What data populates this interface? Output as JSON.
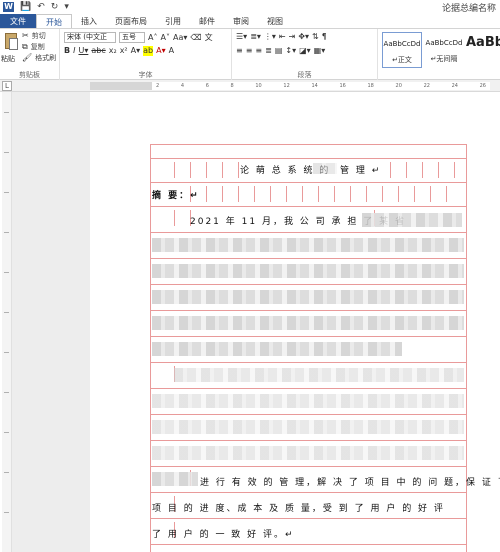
{
  "title_bar": {
    "app_icon": "word-logo",
    "doc_title": "论据总编名称"
  },
  "tabs": [
    "文件",
    "开始",
    "插入",
    "页面布局",
    "引用",
    "邮件",
    "审阅",
    "视图"
  ],
  "active_tab": "开始",
  "ribbon": {
    "clipboard": {
      "paste": "粘贴",
      "cut": "剪切",
      "copy": "复制",
      "format_painter": "格式刷",
      "group_label": "剪贴板"
    },
    "font": {
      "font_name": "宋体 (中文正",
      "font_size": "五号",
      "group_label": "字体"
    },
    "paragraph": {
      "group_label": "段落"
    },
    "styles": {
      "items": [
        {
          "sample": "AaBbCcDd",
          "name": "↵正文"
        },
        {
          "sample": "AaBbCcDd",
          "name": "↵无间隔"
        },
        {
          "sample": "AaBb",
          "name": ""
        }
      ]
    }
  },
  "ruler": {
    "tab_selector": "L",
    "ticks": [
      "4",
      "2",
      "",
      "2",
      "4",
      "6",
      "8",
      "10",
      "12",
      "14",
      "16",
      "18",
      "20",
      "22",
      "24",
      "26"
    ]
  },
  "document": {
    "heading": "论 萌 总 系 统 的",
    "heading_tail": "管 理 ↵",
    "abstract_label": "摘 要：↵",
    "line_date": "2021 年 11 月，我 公 司 承 担 了 某 省",
    "line_body_1": "进 行 有 效 的 管 理，解 决 了 项 目 中 的 问 题，保 证 了",
    "line_body_2": "项 目 的 进 度、成 本 及 质 量，受 到 了 用 户 的 好 评",
    "line_body_3": "了 用 户 的 一 致 好 评。↵"
  },
  "colors": {
    "brand": "#2b579a",
    "grid": "#e99a9a"
  }
}
